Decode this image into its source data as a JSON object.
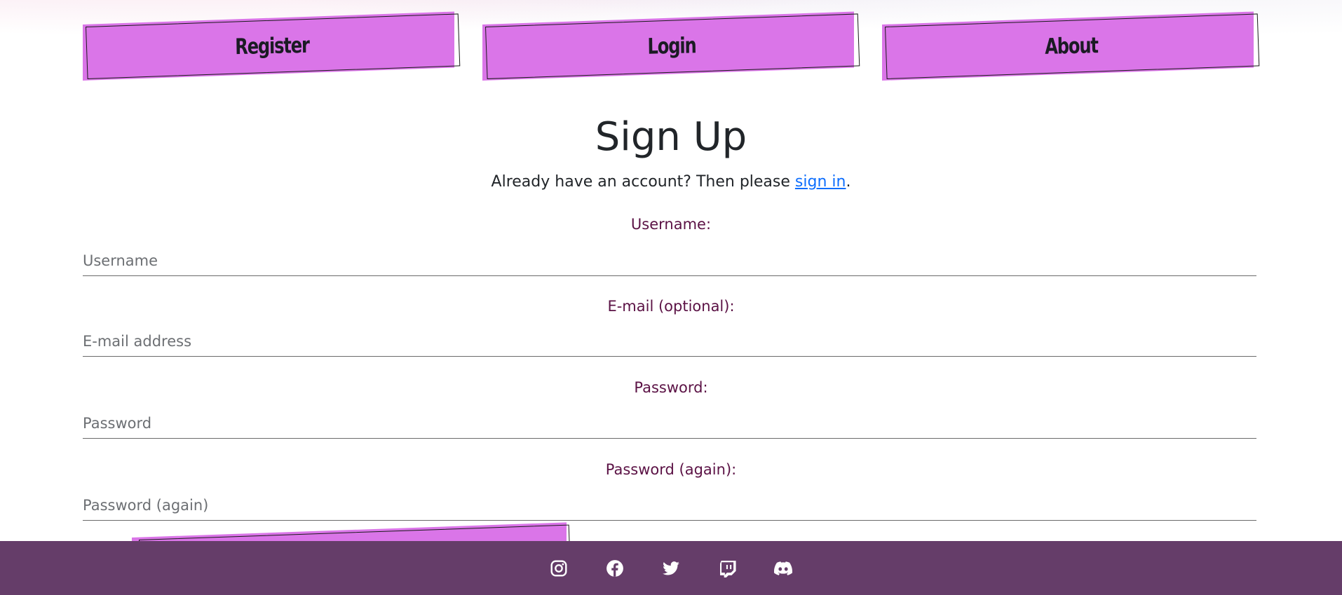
{
  "nav": {
    "items": [
      {
        "label": "Register"
      },
      {
        "label": "Login"
      },
      {
        "label": "About"
      }
    ]
  },
  "signup": {
    "title": "Sign Up",
    "subtitle_prefix": "Already have an account? Then please ",
    "signin_link": "sign in",
    "subtitle_suffix": "."
  },
  "form": {
    "username": {
      "label": "Username:",
      "placeholder": "Username",
      "value": ""
    },
    "email": {
      "label": "E-mail (optional):",
      "placeholder": "E-mail address",
      "value": ""
    },
    "password": {
      "label": "Password:",
      "placeholder": "Password",
      "value": ""
    },
    "password_again": {
      "label": "Password (again):",
      "placeholder": "Password (again)",
      "value": ""
    }
  },
  "footer": {
    "icons": [
      "instagram-icon",
      "facebook-icon",
      "twitter-icon",
      "twitch-icon",
      "discord-icon"
    ]
  },
  "colors": {
    "accent": "#da75e8",
    "footer_bg": "#653d69",
    "label": "#5b1245",
    "link": "#0d6efd"
  }
}
